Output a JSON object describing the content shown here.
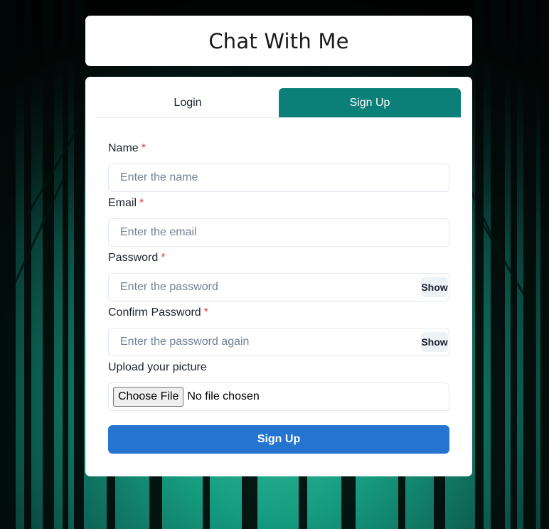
{
  "header": {
    "title": "Chat With Me"
  },
  "tabs": [
    {
      "label": "Login",
      "active": false
    },
    {
      "label": "Sign Up",
      "active": true
    }
  ],
  "form": {
    "name": {
      "label": "Name",
      "required_mark": "*",
      "placeholder": "Enter the name",
      "value": ""
    },
    "email": {
      "label": "Email",
      "required_mark": "*",
      "placeholder": "Enter the email",
      "value": ""
    },
    "password": {
      "label": "Password",
      "required_mark": "*",
      "placeholder": "Enter the password",
      "value": "",
      "toggle_label": "Show"
    },
    "confirm_password": {
      "label": "Confirm Password",
      "required_mark": "*",
      "placeholder": "Enter the password again",
      "value": "",
      "toggle_label": "Show"
    },
    "picture": {
      "label": "Upload your picture",
      "button_label": "Choose File",
      "status": "No file chosen"
    },
    "submit_label": "Sign Up"
  },
  "colors": {
    "accent_tab": "#0c8078",
    "submit": "#2574cf",
    "required": "#e53e3e"
  },
  "background": {
    "description_icon": "forest-background"
  }
}
